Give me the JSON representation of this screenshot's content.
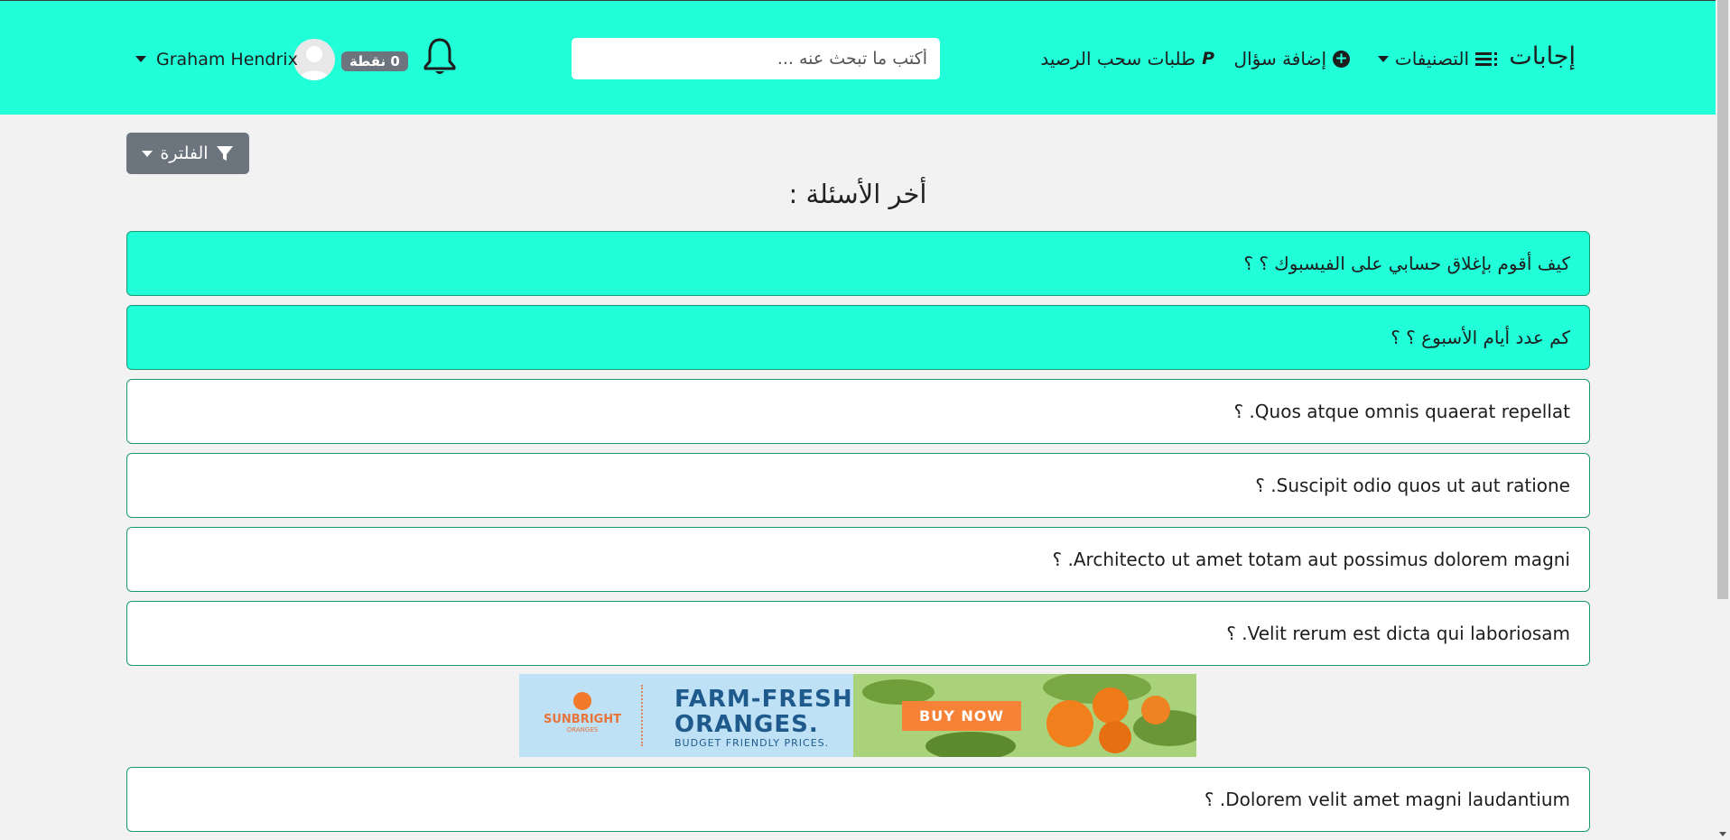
{
  "header": {
    "brand": "إجابات",
    "nav": {
      "categories": "التصنيفات",
      "add_question": "إضافة سؤال",
      "withdraw_requests": "طلبات سحب الرصيد"
    },
    "search": {
      "placeholder": "أكتب ما تبحث عنه ..."
    },
    "user": {
      "name": "Graham Hendrix",
      "points": "0 نقطة"
    }
  },
  "filter": {
    "label": "الفلترة"
  },
  "page_title": "أخر الأسئلة :",
  "questions": [
    {
      "text": "كيف أقوم بإغلاق حسابي على الفيسبوك ؟ ؟",
      "highlighted": true
    },
    {
      "text": "كم عدد أيام الأسبوع ؟ ؟",
      "highlighted": true
    },
    {
      "text": "Quos atque omnis quaerat repellat. ؟",
      "highlighted": false
    },
    {
      "text": "Suscipit odio quos ut aut ratione. ؟",
      "highlighted": false
    },
    {
      "text": "Architecto ut amet totam aut possimus dolorem magni. ؟",
      "highlighted": false
    },
    {
      "text": "Velit rerum est dicta qui laboriosam. ؟",
      "highlighted": false
    },
    {
      "text": "Dolorem velit amet magni laudantium. ؟",
      "highlighted": false
    }
  ],
  "ad": {
    "brand": "SUNBRIGHT",
    "brand_sub": "ORANGES",
    "headline_1": "FARM-FRESH",
    "headline_2": "ORANGES.",
    "tagline": "BUDGET FRIENDLY PRICES.",
    "button": "BUY NOW"
  },
  "icons": {
    "categories": "list-icon",
    "add": "plus-circle-icon",
    "withdraw": "paypal-icon",
    "notifications": "bell-icon",
    "filter": "filter-icon"
  },
  "colors": {
    "header_bg": "#20ffd8",
    "highlight_bg": "#20ffd8",
    "card_border": "#1a9a72",
    "badge_bg": "#6c757d",
    "ad_button": "#f58236"
  }
}
